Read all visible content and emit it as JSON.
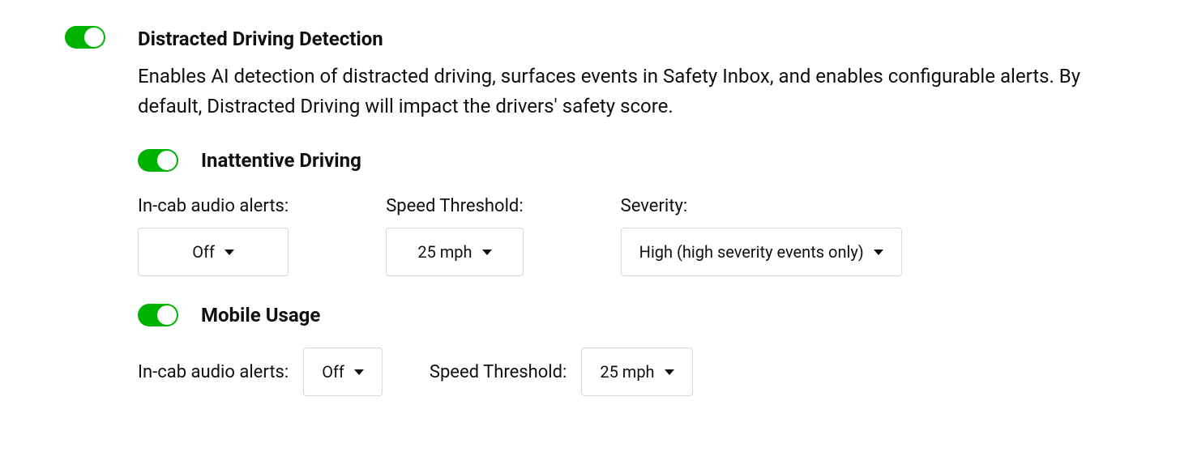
{
  "main": {
    "toggle_on": true,
    "title": "Distracted Driving Detection",
    "description": "Enables AI detection of distracted driving, surfaces events in Safety Inbox, and enables configurable alerts. By default, Distracted Driving will impact the drivers' safety score."
  },
  "inattentive": {
    "toggle_on": true,
    "title": "Inattentive Driving",
    "audio_label": "In-cab audio alerts:",
    "audio_value": "Off",
    "speed_label": "Speed Threshold:",
    "speed_value": "25 mph",
    "severity_label": "Severity:",
    "severity_value": "High (high severity events only)"
  },
  "mobile": {
    "toggle_on": true,
    "title": "Mobile Usage",
    "audio_label": "In-cab audio alerts:",
    "audio_value": "Off",
    "speed_label": "Speed Threshold:",
    "speed_value": "25 mph"
  }
}
